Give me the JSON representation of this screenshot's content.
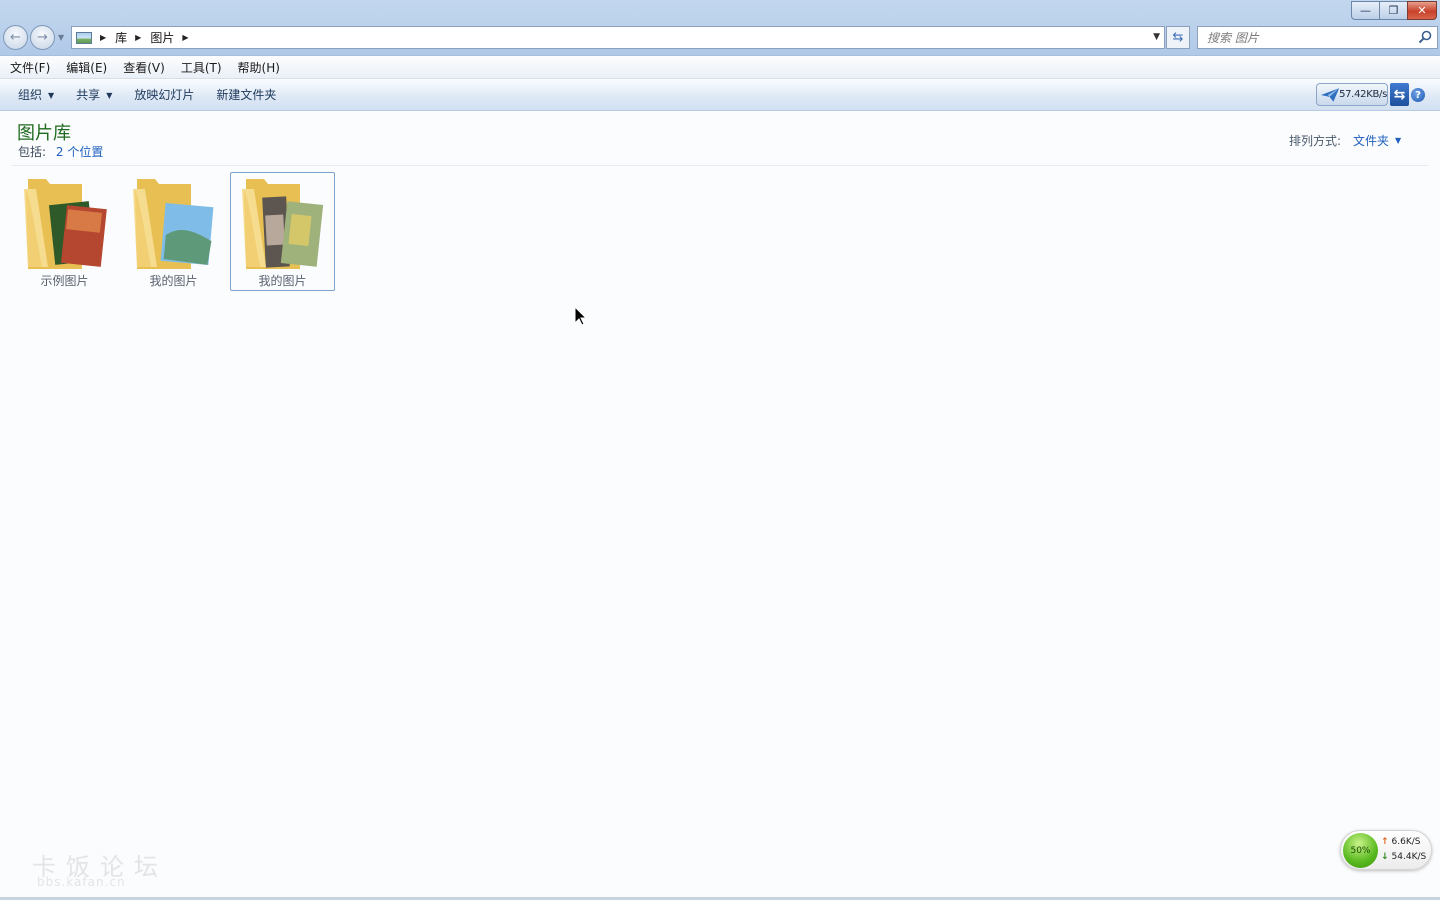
{
  "window": {
    "controls": {
      "minimize": "—",
      "restore": "❐",
      "close": "✕"
    }
  },
  "navigation": {
    "back": "←",
    "forward": "→",
    "breadcrumb": [
      "库",
      "图片"
    ]
  },
  "search": {
    "placeholder": "搜索 图片"
  },
  "menubar": {
    "items": [
      "文件(F)",
      "编辑(E)",
      "查看(V)",
      "工具(T)",
      "帮助(H)"
    ]
  },
  "toolbar": {
    "organize": "组织",
    "share": "共享",
    "slideshow": "放映幻灯片",
    "new_folder": "新建文件夹",
    "speed": "57.42KB/s"
  },
  "library": {
    "title": "图片库",
    "includes_label": "包括:",
    "locations": "2 个位置",
    "sort_label": "排列方式:",
    "sort_value": "文件夹"
  },
  "folders": [
    {
      "name": "示例图片",
      "selected": false
    },
    {
      "name": "我的图片",
      "selected": false
    },
    {
      "name": "我的图片",
      "selected": true
    }
  ],
  "watermark": {
    "name": "卡饭论坛",
    "url": "bbs.kafan.cn"
  },
  "netmon": {
    "percent": "50%",
    "upload": "6.6K/S",
    "download": "54.4K/S"
  },
  "colors": {
    "title_green": "#1e6a1e",
    "link_blue": "#1f5fbf",
    "folder_yellow": "#f3d47a"
  }
}
